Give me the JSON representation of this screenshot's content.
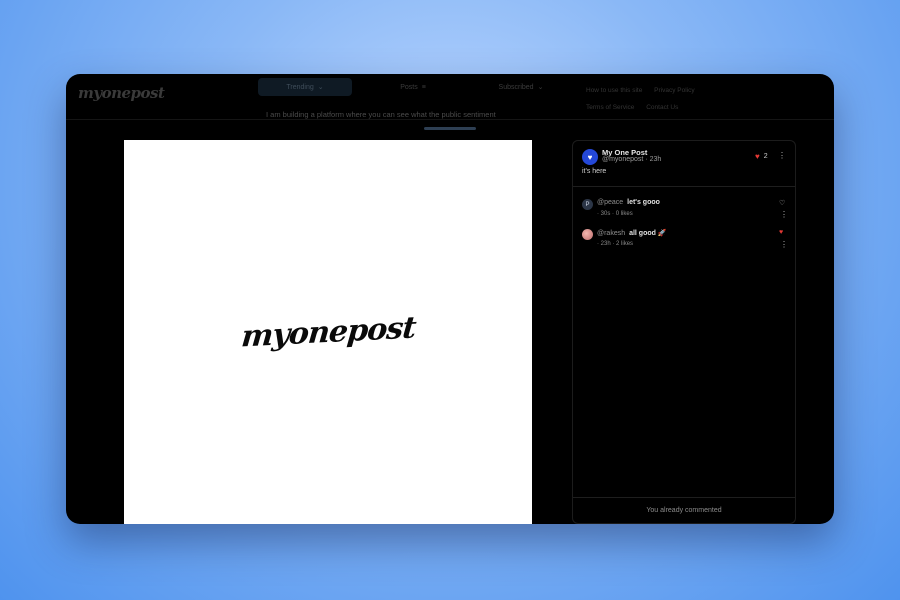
{
  "app": {
    "logo_text": "myonepost",
    "tabs": [
      {
        "label": "Trending",
        "active": true
      },
      {
        "label": "Posts",
        "active": false
      },
      {
        "label": "Subscribed",
        "active": false
      }
    ],
    "header_links": [
      "How to use this site",
      "Privacy Policy",
      "Terms of Service",
      "Contact Us"
    ],
    "tagline": "I am building a platform where you can see what the public sentiment"
  },
  "post_image": {
    "logo_text": "myonepost"
  },
  "post": {
    "avatar_glyph": "♥",
    "author_name": "My One Post",
    "handle": "@myonepost",
    "time": "23h",
    "text": "it's here",
    "likes": "2",
    "liked": true
  },
  "comments": [
    {
      "avatar_initial": "P",
      "user": "@peace",
      "text": "let's gooo",
      "time": "30s",
      "likes": "0 likes",
      "liked": false
    },
    {
      "avatar_initial": "R",
      "user": "@rakesh",
      "text": "all good 🚀",
      "time": "23h",
      "likes": "2 likes",
      "liked": true
    }
  ],
  "footer": {
    "status_text": "You already commented"
  },
  "colors": {
    "accent": "#2448d8",
    "like": "#e53935",
    "background": "#000000"
  }
}
